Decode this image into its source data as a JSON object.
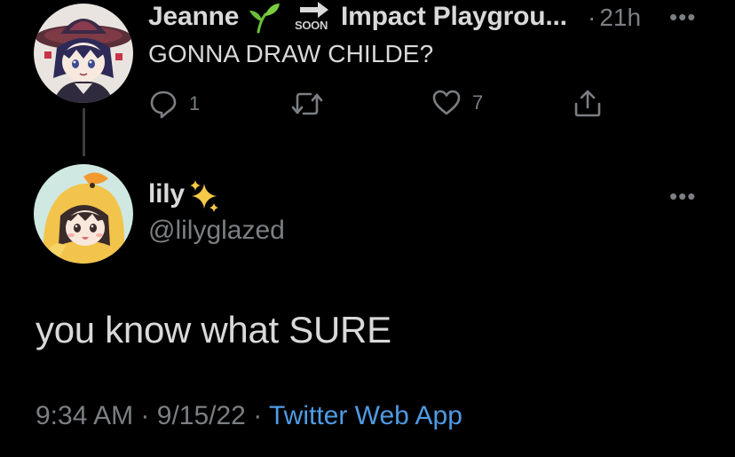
{
  "parent_tweet": {
    "author_name": "Jeanne",
    "name_emoji": "🌱",
    "soon_label": "SOON",
    "community_name": "Impact Playgrou...",
    "separator": "·",
    "time": "21h",
    "text": "GONNA DRAW CHILDE?",
    "reply_count": "1",
    "like_count": "7",
    "more_label": "•••"
  },
  "reply_tweet": {
    "author_name": "lily",
    "name_emoji": "✨",
    "handle": "@lilyglazed",
    "text": "you know what SURE",
    "time": "9:34 AM",
    "date": "9/15/22",
    "separator": "·",
    "source": "Twitter Web App",
    "more_label": "•••"
  },
  "colors": {
    "background": "#000000",
    "text": "#d9d9d9",
    "muted": "#7b7f83",
    "link": "#4f9be3",
    "thread_line": "#3d3d3d"
  },
  "icons": {
    "reply": "reply-icon",
    "retweet": "retweet-icon",
    "like": "heart-icon",
    "share": "share-icon",
    "arrow": "right-arrow-icon"
  }
}
